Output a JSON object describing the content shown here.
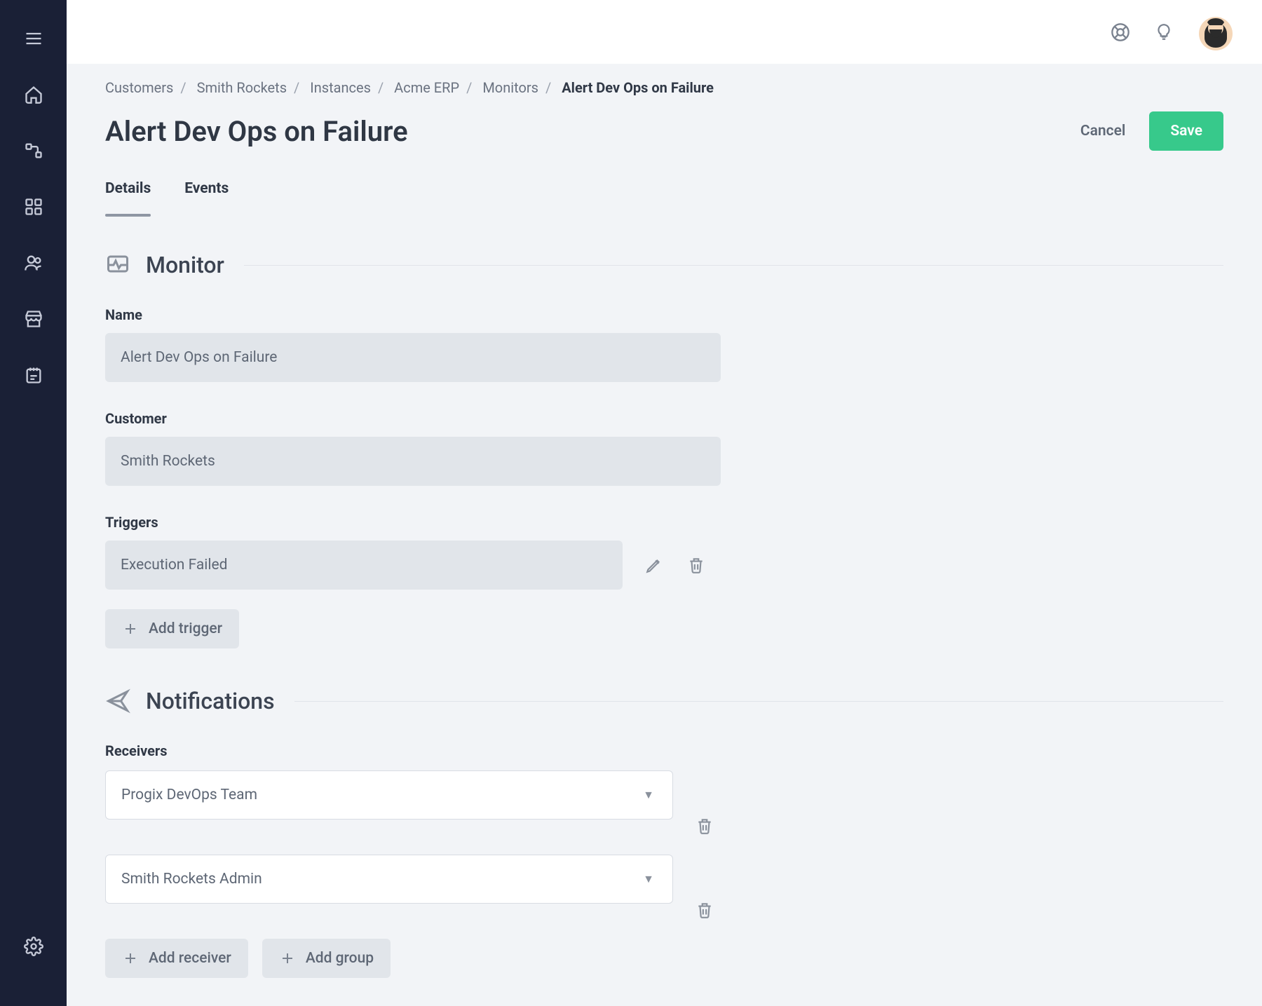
{
  "breadcrumb": {
    "items": [
      "Customers",
      "Smith Rockets",
      "Instances",
      "Acme ERP",
      "Monitors"
    ],
    "current": "Alert Dev Ops on Failure"
  },
  "page": {
    "title": "Alert Dev Ops on Failure",
    "cancel_label": "Cancel",
    "save_label": "Save"
  },
  "tabs": {
    "details_label": "Details",
    "events_label": "Events"
  },
  "monitor_section": {
    "title": "Monitor",
    "name_label": "Name",
    "name_value": "Alert Dev Ops on Failure",
    "customer_label": "Customer",
    "customer_value": "Smith Rockets",
    "triggers_label": "Triggers",
    "trigger_value": "Execution Failed",
    "add_trigger_label": "Add trigger"
  },
  "notifications_section": {
    "title": "Notifications",
    "receivers_label": "Receivers",
    "receivers": [
      {
        "label": "Progix DevOps Team"
      },
      {
        "label": "Smith Rockets Admin"
      }
    ],
    "add_receiver_label": "Add receiver",
    "add_group_label": "Add group"
  }
}
